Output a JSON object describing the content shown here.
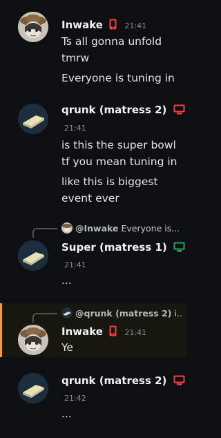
{
  "messages": [
    {
      "author": "Inwake",
      "device": "phone-icon",
      "time": "21:41",
      "lines": [
        "Ts all gonna unfold",
        "tmrw",
        "Everyone is tuning in"
      ]
    },
    {
      "author": "qrunk (matress 2)",
      "device": "monitor-icon",
      "time": "21:41",
      "lines": [
        "is this the super bowl",
        "tf you mean tuning in",
        "like this is biggest",
        "event ever"
      ]
    },
    {
      "reply_author": "@Inwake",
      "reply_text": "Everyone is...",
      "author": "Super (matress 1)",
      "device": "monitor-icon",
      "time": "21:41",
      "lines": [
        "..."
      ]
    },
    {
      "reply_author": "@qrunk (matress 2)",
      "reply_text": "i...",
      "author": "Inwake",
      "device": "phone-icon",
      "time": "21:41",
      "lines": [
        "Ye"
      ]
    },
    {
      "author": "qrunk (matress 2)",
      "device": "monitor-icon",
      "time": "21:42",
      "lines": [
        "..."
      ]
    }
  ],
  "colors": {
    "background": "#0e0f12",
    "mention_highlight_border": "#e6a23c",
    "phone_icon": "#f23f43",
    "monitor_red": "#f23f43",
    "monitor_green": "#23a55a"
  }
}
